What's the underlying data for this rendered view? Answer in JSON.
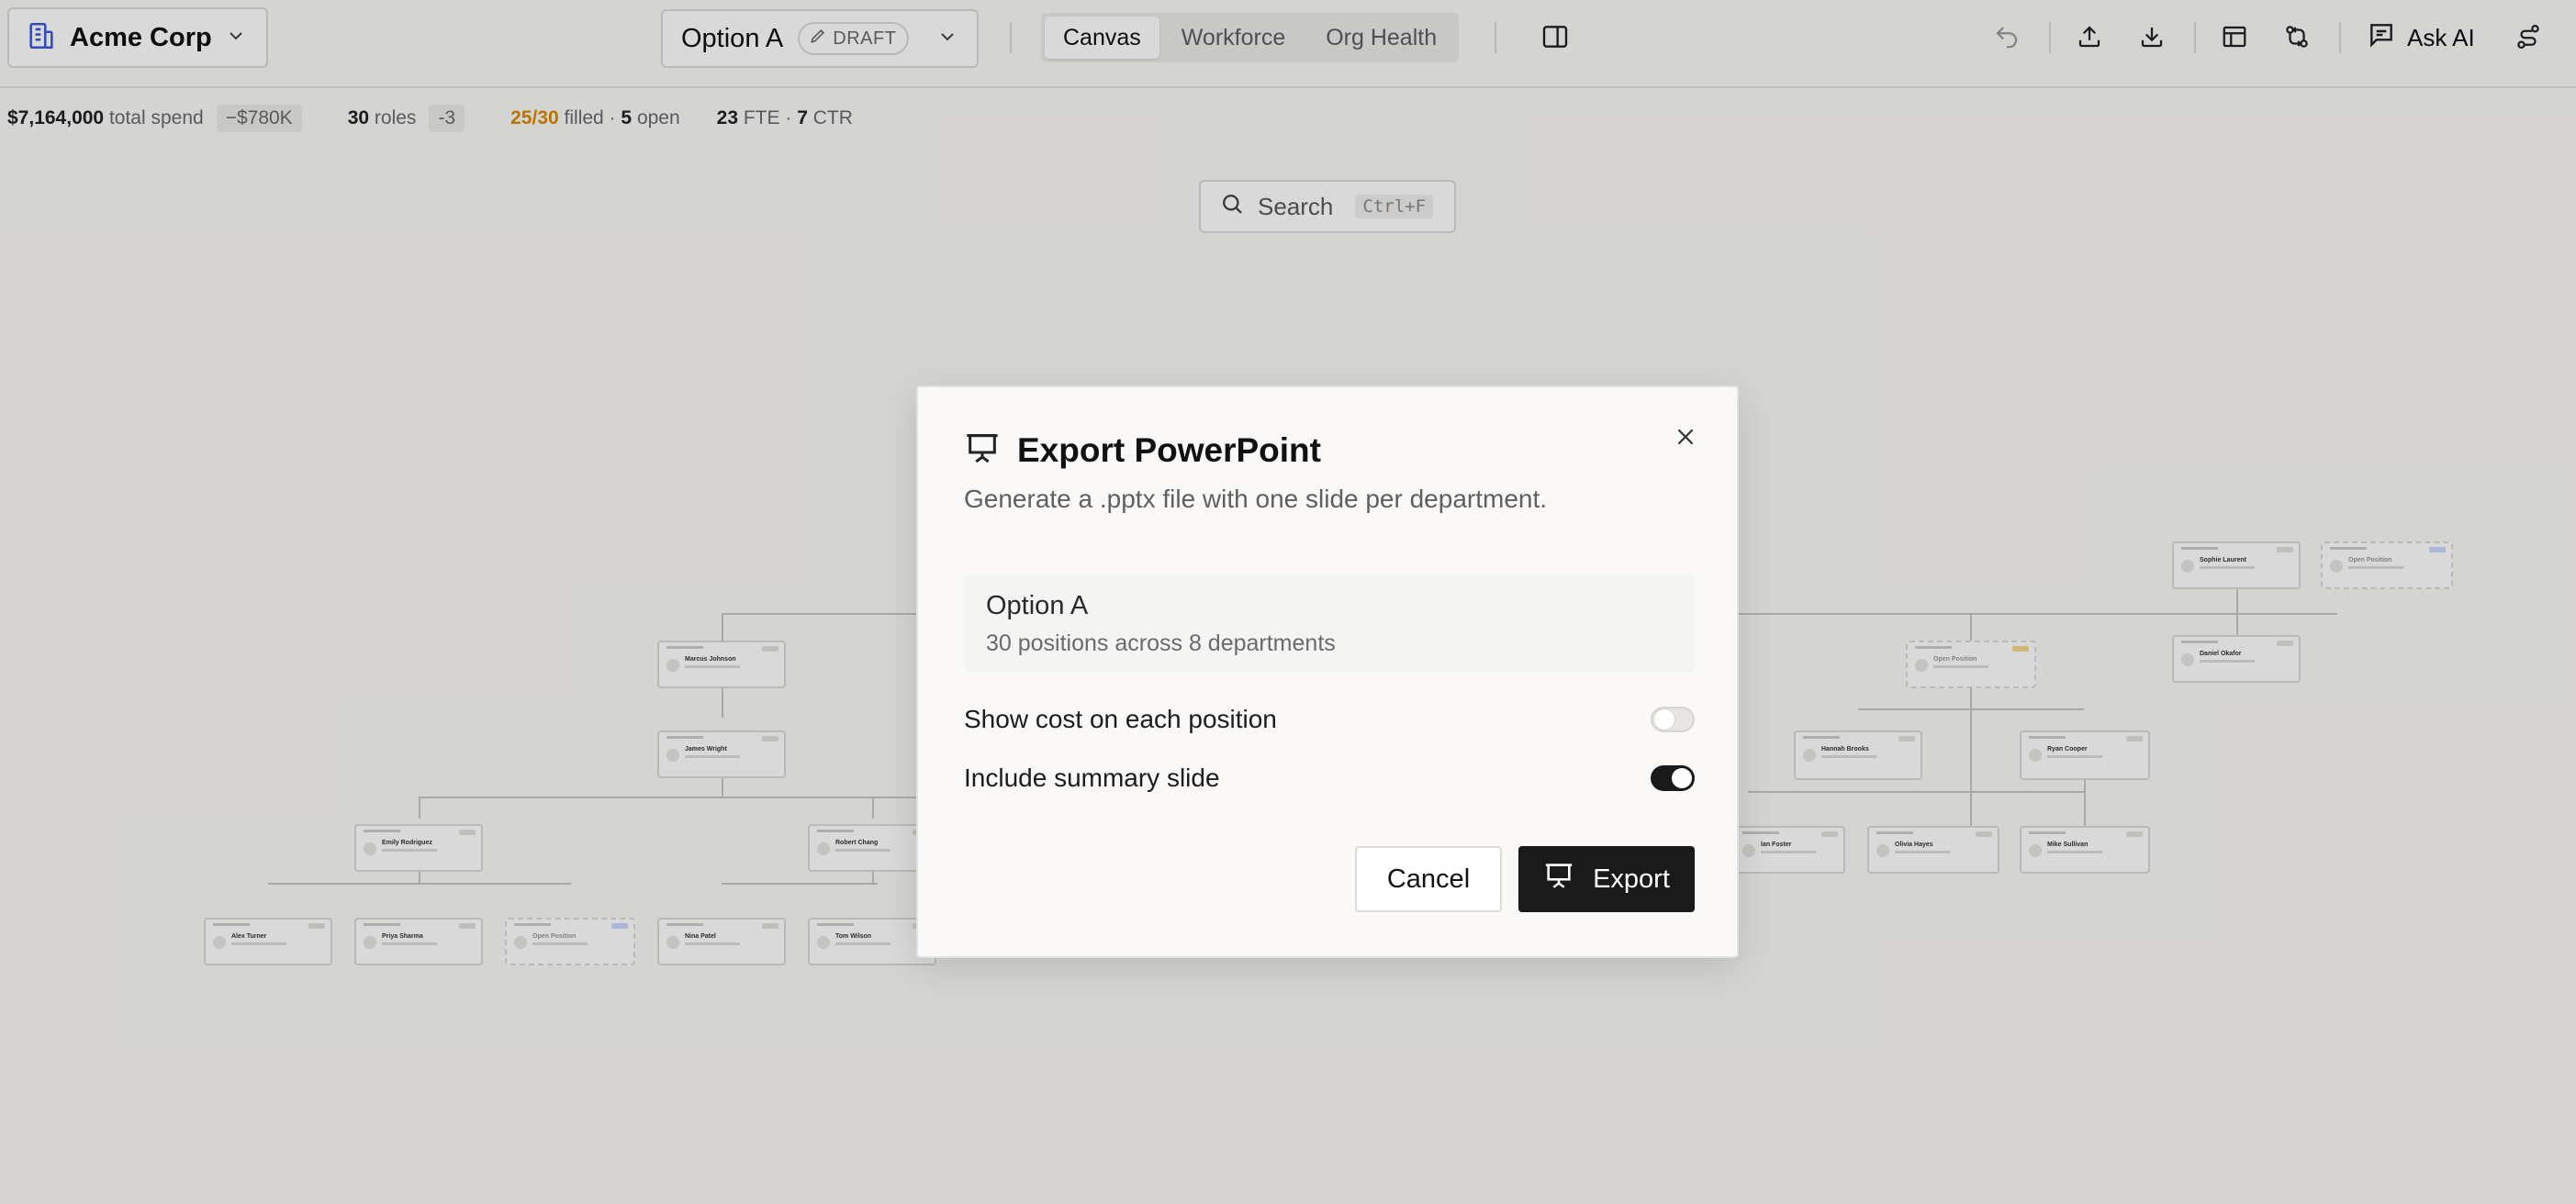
{
  "header": {
    "org_name": "Acme Corp",
    "option_name": "Option A",
    "draft_label": "DRAFT",
    "tabs": [
      {
        "label": "Canvas",
        "active": true
      },
      {
        "label": "Workforce",
        "active": false
      },
      {
        "label": "Org Health",
        "active": false
      }
    ],
    "ask_ai_label": "Ask AI"
  },
  "stats": {
    "total_spend_value": "$7,164,000",
    "total_spend_label": "total spend",
    "total_spend_delta": "−$780K",
    "roles_value": "30",
    "roles_label": "roles",
    "roles_delta": "-3",
    "filled_value": "25/30",
    "filled_label": "filled ·",
    "open_value": "5",
    "open_label": "open",
    "fte_value": "23",
    "fte_label": "FTE ·",
    "ctr_value": "7",
    "ctr_label": "CTR"
  },
  "search": {
    "label": "Search",
    "shortcut": "Ctrl+F"
  },
  "org_chart": {
    "nodes": [
      {
        "name": "Marcus Johnson"
      },
      {
        "name": "James Wright"
      },
      {
        "name": "Emily Rodriguez"
      },
      {
        "name": "Robert Chang"
      },
      {
        "name": "Alex Turner"
      },
      {
        "name": "Priya Sharma"
      },
      {
        "name": "Open Position"
      },
      {
        "name": "Nina Patel"
      },
      {
        "name": "Tom Wilson"
      },
      {
        "name": "Sophie Laurent"
      },
      {
        "name": "Open Position"
      },
      {
        "name": "Daniel Okafor"
      },
      {
        "name": "Open Position"
      },
      {
        "name": "Hannah Brooks"
      },
      {
        "name": "Ryan Cooper"
      },
      {
        "name": "Ian Foster"
      },
      {
        "name": "Olivia Hayes"
      },
      {
        "name": "Mike Sullivan"
      }
    ]
  },
  "modal": {
    "title": "Export PowerPoint",
    "description": "Generate a .pptx file with one slide per department.",
    "summary_name": "Option A",
    "summary_meta": "30 positions across 8 departments",
    "options": [
      {
        "label": "Show cost on each position",
        "enabled": false
      },
      {
        "label": "Include summary slide",
        "enabled": true
      }
    ],
    "cancel_label": "Cancel",
    "export_label": "Export"
  },
  "colors": {
    "accent_dark": "#1a1a1a",
    "filled_highlight": "#d98a00",
    "org_icon": "#3b5bdb"
  }
}
